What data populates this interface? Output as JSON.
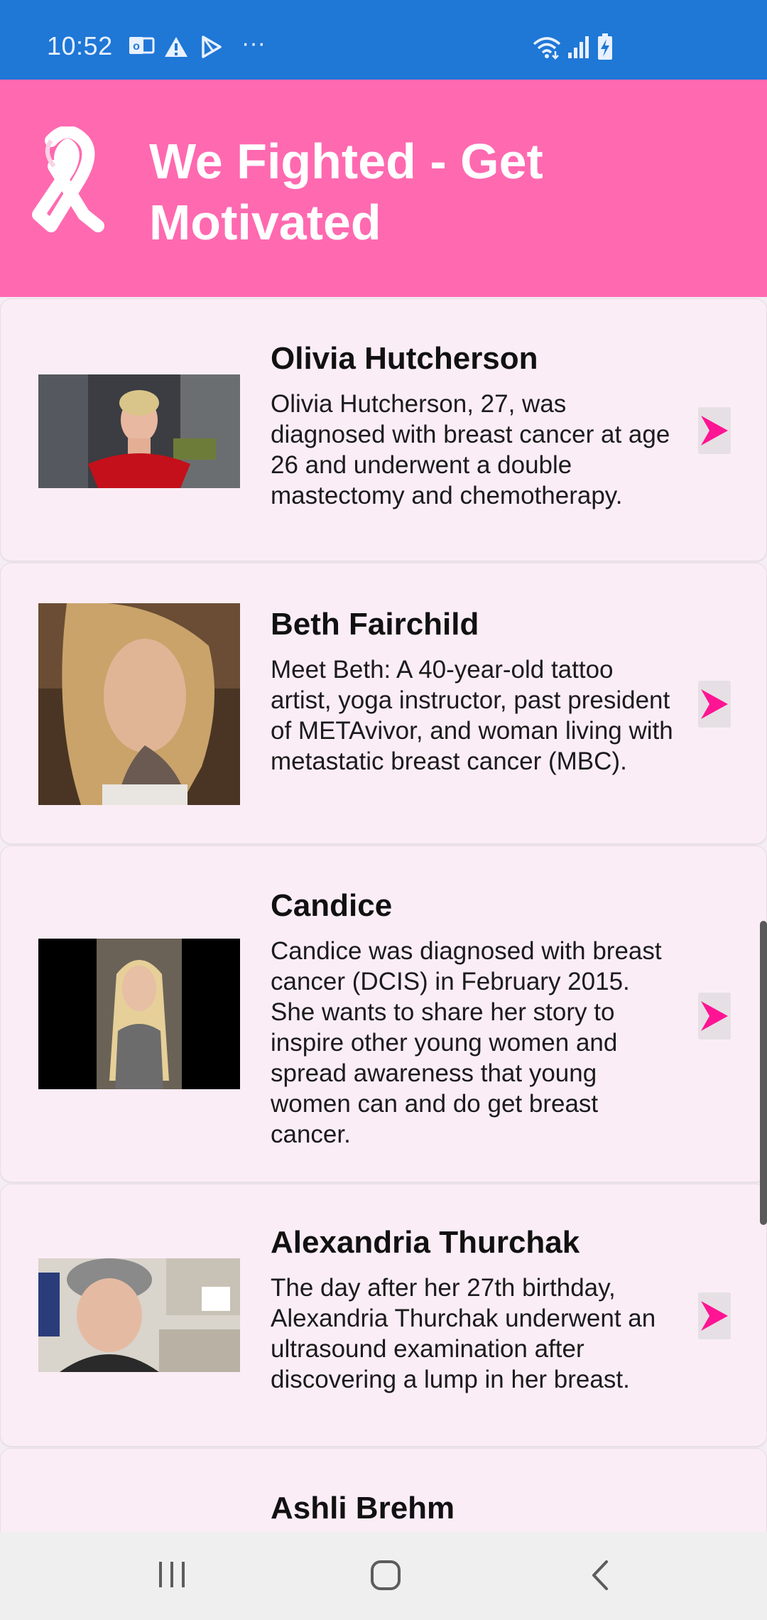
{
  "status_bar": {
    "time": "10:52",
    "icons": [
      "outlook-icon",
      "warning-icon",
      "play-store-icon",
      "more-icon",
      "wifi-icon",
      "signal-icon",
      "battery-charging-icon"
    ],
    "more": "···"
  },
  "header": {
    "title": "We Fighted - Get Motivated",
    "logo": "pink-ribbon-icon"
  },
  "stories": [
    {
      "name": "Olivia Hutcherson",
      "description": "Olivia Hutcherson, 27, was diagnosed with breast cancer at age 26 and underwent a double mastectomy and chemotherapy."
    },
    {
      "name": "Beth Fairchild",
      "description": "Meet Beth: A 40-year-old tattoo artist, yoga instructor, past president of METAvivor, and woman living with metastatic breast cancer (MBC)."
    },
    {
      "name": "Candice",
      "description": "Candice was diagnosed with breast cancer (DCIS) in February 2015. She wants to share her story to inspire other young women and spread awareness that young women can and do get breast cancer."
    },
    {
      "name": "Alexandria Thurchak",
      "description": "The day after her 27th birthday, Alexandria Thurchak underwent an ultrasound examination after discovering a lump in her breast."
    },
    {
      "name": "Ashli Brehm",
      "description": ""
    }
  ],
  "colors": {
    "status_bar": "#1f77d6",
    "header": "#ff69b0",
    "card": "#fbedf6",
    "arrow": "#ff1493"
  },
  "nav_bar": {
    "buttons": [
      "recent-apps-icon",
      "home-icon",
      "back-icon"
    ]
  }
}
